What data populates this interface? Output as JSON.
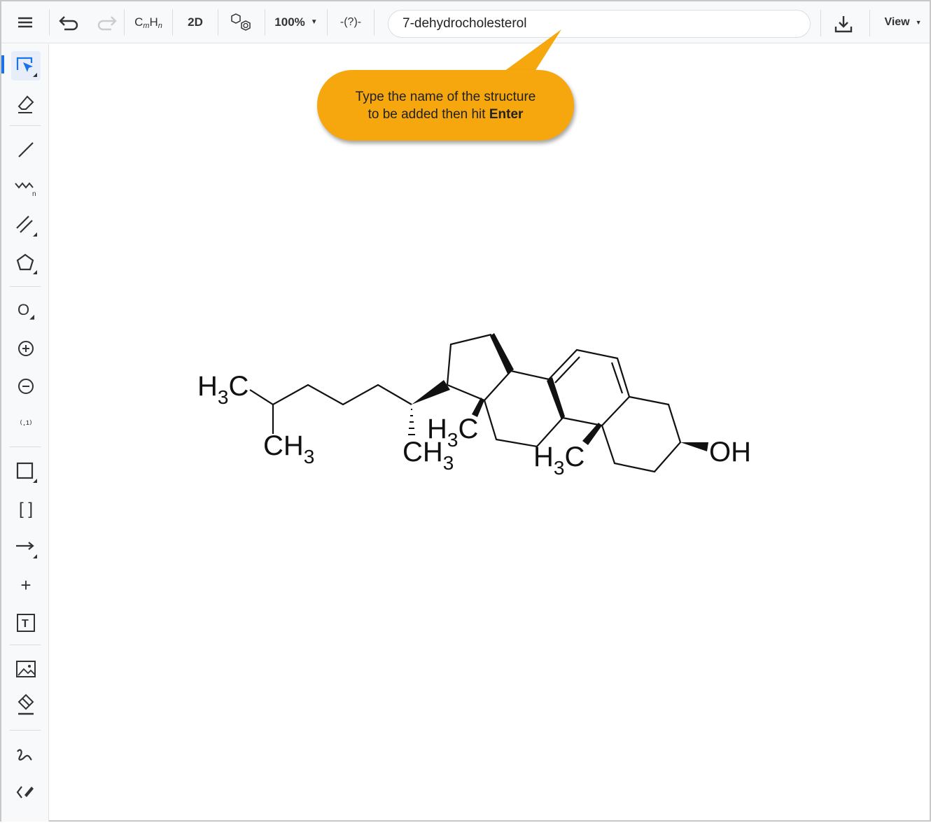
{
  "toolbar": {
    "menu": "menu-icon",
    "undo": "undo-icon",
    "redo": "redo-icon",
    "formula_c": "C",
    "formula_m": "m",
    "formula_h": "H",
    "formula_n": "n",
    "mode": "2D",
    "zoom": "100%",
    "search_value": "7-dehydrocholesterol",
    "view": "View"
  },
  "tooltip": {
    "line1": "Type the name of the structure",
    "line2": "to be added then hit ",
    "line2_bold": "Enter",
    "color": "#f5a70d"
  },
  "molecule": {
    "name": "7-dehydrocholesterol",
    "labels": {
      "h3c_1": "H",
      "h3c_2": "H",
      "h3c_3": "H",
      "c": "C",
      "three": "3",
      "ch3": "CH",
      "oh": "OH"
    }
  },
  "sidebar": [
    "select",
    "eraser",
    "single-bond",
    "chain",
    "multiple-bond",
    "ring",
    "atom",
    "charge-plus",
    "charge-minus",
    "atom-mapping",
    "shape",
    "sgroup-brackets",
    "reaction-arrow",
    "reaction-plus",
    "text",
    "image",
    "clear",
    "freehand",
    "stereo"
  ],
  "accent": "#1a73e8"
}
